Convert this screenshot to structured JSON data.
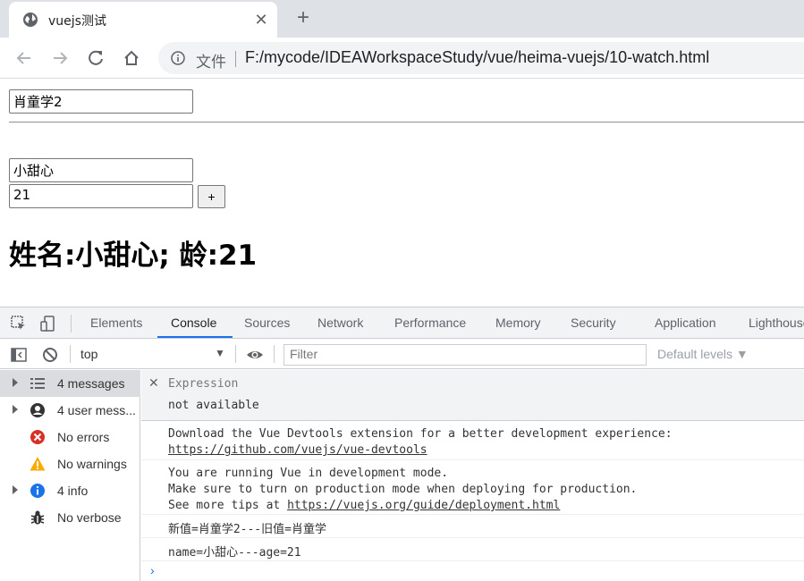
{
  "browser": {
    "tab_title": "vuejs测试",
    "tab_close": "✕",
    "new_tab": "+",
    "url_label": "文件",
    "url": "F:/mycode/IDEAWorkspaceStudy/vue/heima-vuejs/10-watch.html"
  },
  "page": {
    "message_value": "肖童学2",
    "name_value": "小甜心",
    "age_value": "21",
    "plus_label": "+",
    "result_text": "姓名:小甜心; 龄:21"
  },
  "devtools": {
    "tabs": [
      "Elements",
      "Console",
      "Sources",
      "Network",
      "Performance",
      "Memory",
      "Security",
      "Application",
      "Lighthouse"
    ],
    "active_tab": "Console",
    "context": "top",
    "filter_placeholder": "Filter",
    "levels": "Default levels ▼",
    "sidebar": [
      {
        "label": "4 messages",
        "icon": "list-icon",
        "caret": true,
        "selected": true
      },
      {
        "label": "4 user mess...",
        "icon": "user-icon",
        "caret": true,
        "selected": false
      },
      {
        "label": "No errors",
        "icon": "error-icon",
        "caret": false,
        "selected": false
      },
      {
        "label": "No warnings",
        "icon": "warning-icon",
        "caret": false,
        "selected": false
      },
      {
        "label": "4 info",
        "icon": "info-icon",
        "caret": true,
        "selected": false
      },
      {
        "label": "No verbose",
        "icon": "bug-icon",
        "caret": false,
        "selected": false
      }
    ],
    "live_expression": {
      "label": "Expression",
      "value": "not available"
    },
    "messages": {
      "m1_line1": "Download the Vue Devtools extension for a better development experience:",
      "m1_link": "https://github.com/vuejs/vue-devtools",
      "m2_line1": "You are running Vue in development mode.",
      "m2_line2": "Make sure to turn on production mode when deploying for production.",
      "m2_line3_prefix": "See more tips at ",
      "m2_link": "https://vuejs.org/guide/deployment.html",
      "m3": "新值=肖童学2---旧值=肖童学",
      "m4": "name=小甜心---age=21"
    },
    "prompt": "›"
  },
  "colors": {
    "accent": "#1a73e8",
    "error": "#d93025",
    "warning": "#f9ab00",
    "info": "#1a73e8"
  }
}
